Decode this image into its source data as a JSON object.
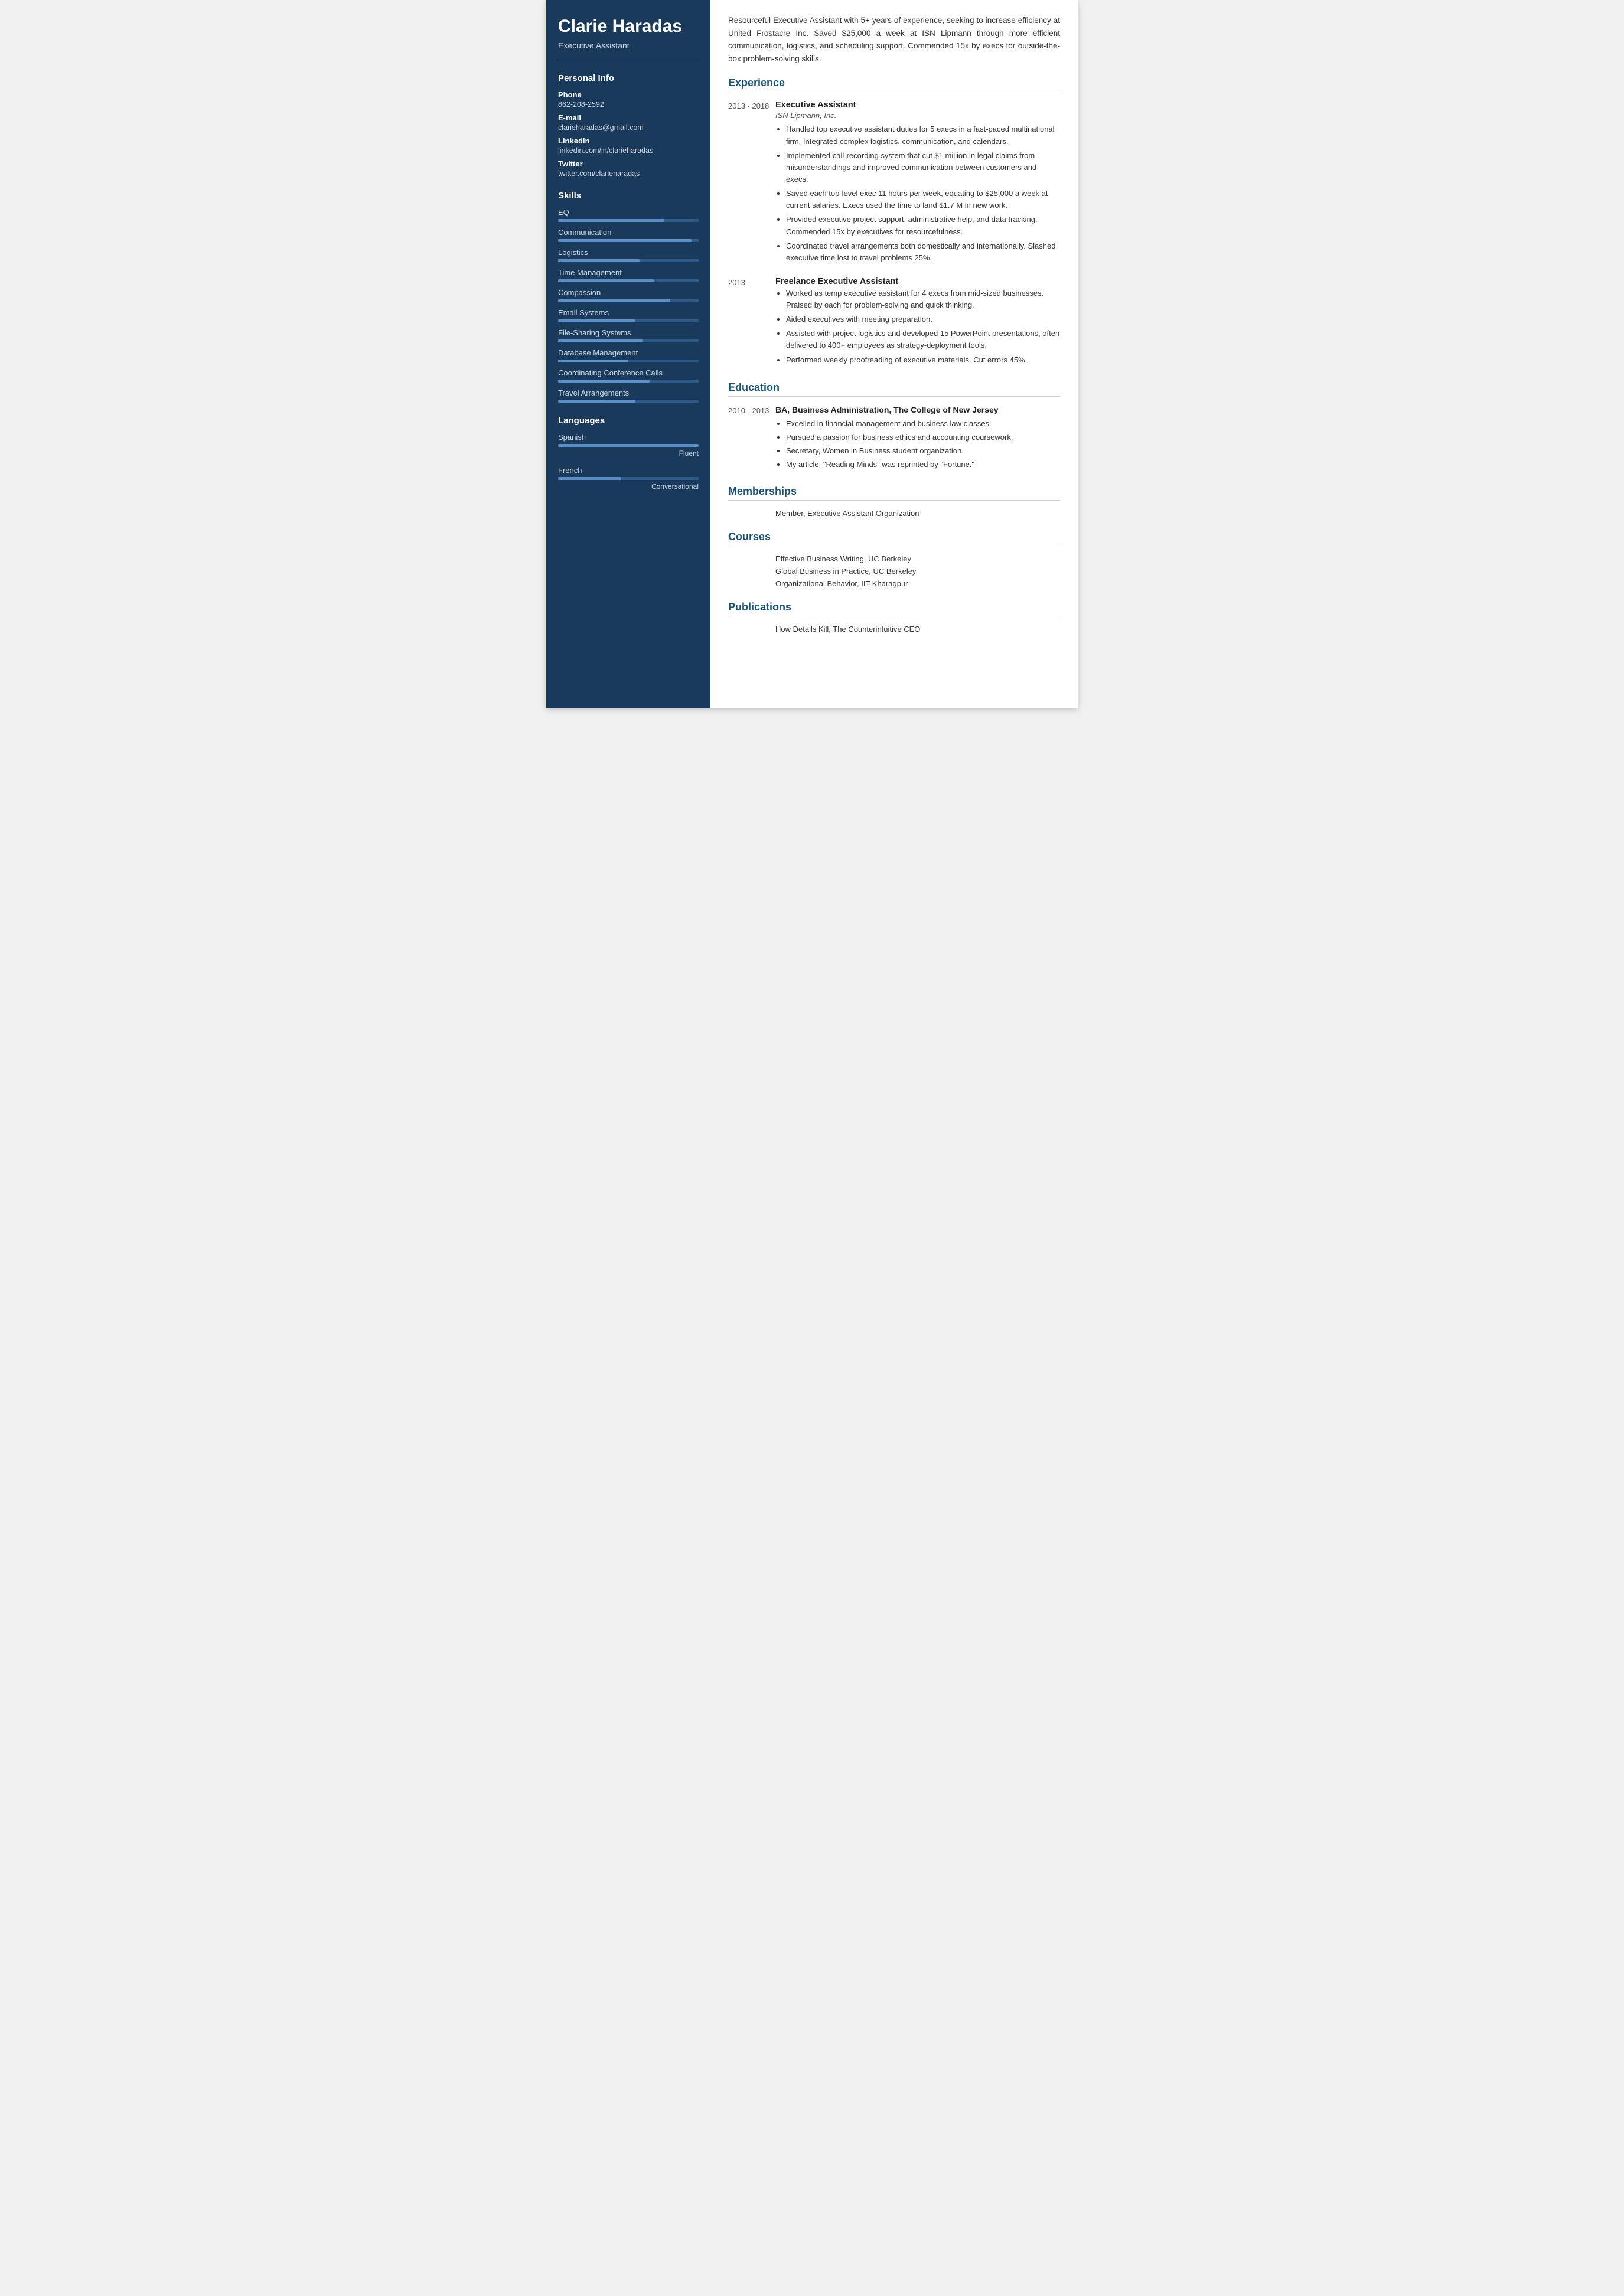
{
  "sidebar": {
    "name": "Clarie Haradas",
    "title": "Executive Assistant",
    "personal_info": {
      "label": "Personal Info",
      "phone_label": "Phone",
      "phone": "862-208-2592",
      "email_label": "E-mail",
      "email": "clarieharadas@gmail.com",
      "linkedin_label": "LinkedIn",
      "linkedin": "linkedin.com/in/clarieharadas",
      "twitter_label": "Twitter",
      "twitter": "twitter.com/clarieharadas"
    },
    "skills": {
      "label": "Skills",
      "items": [
        {
          "name": "EQ",
          "pct": 75
        },
        {
          "name": "Communication",
          "pct": 95
        },
        {
          "name": "Logistics",
          "pct": 58
        },
        {
          "name": "Time Management",
          "pct": 68
        },
        {
          "name": "Compassion",
          "pct": 80
        },
        {
          "name": "Email Systems",
          "pct": 55
        },
        {
          "name": "File-Sharing Systems",
          "pct": 60
        },
        {
          "name": "Database Management",
          "pct": 50
        },
        {
          "name": "Coordinating Conference Calls",
          "pct": 65
        },
        {
          "name": "Travel Arrangements",
          "pct": 55
        }
      ]
    },
    "languages": {
      "label": "Languages",
      "items": [
        {
          "name": "Spanish",
          "pct": 100,
          "level": "Fluent"
        },
        {
          "name": "French",
          "pct": 45,
          "level": "Conversational"
        }
      ]
    }
  },
  "main": {
    "summary": "Resourceful Executive Assistant with 5+ years of experience, seeking to increase efficiency at United Frostacre Inc. Saved $25,000 a week at ISN Lipmann through more efficient communication, logistics, and scheduling support. Commended 15x by execs for outside-the-box problem-solving skills.",
    "experience": {
      "label": "Experience",
      "entries": [
        {
          "date": "2013 - 2018",
          "title": "Executive Assistant",
          "company": "ISN Lipmann, Inc.",
          "bullets": [
            "Handled top executive assistant duties for 5 execs in a fast-paced multinational firm. Integrated complex logistics, communication, and calendars.",
            "Implemented call-recording system that cut $1 million in legal claims from misunderstandings and improved communication between customers and execs.",
            "Saved each top-level exec 11 hours per week, equating to $25,000 a week at current salaries. Execs used the time to land $1.7 M in new work.",
            "Provided executive project support, administrative help, and data tracking. Commended 15x by executives for resourcefulness.",
            "Coordinated travel arrangements both domestically and internationally. Slashed executive time lost to travel problems 25%."
          ]
        },
        {
          "date": "2013",
          "title": "Freelance Executive Assistant",
          "company": "",
          "bullets": [
            "Worked as temp executive assistant for 4 execs from mid-sized businesses. Praised by each for problem-solving and quick thinking.",
            "Aided executives with meeting preparation.",
            "Assisted with project logistics and developed 15 PowerPoint presentations, often delivered to 400+ employees as strategy-deployment tools.",
            "Performed weekly proofreading of executive materials. Cut errors 45%."
          ]
        }
      ]
    },
    "education": {
      "label": "Education",
      "entries": [
        {
          "date": "2010 - 2013",
          "degree": "BA, Business Administration, The College of New Jersey",
          "bullets": [
            "Excelled in financial management and business law classes.",
            "Pursued a passion for business ethics and accounting coursework.",
            "Secretary, Women in Business student organization.",
            "My article, \"Reading Minds\" was reprinted by \"Fortune.\""
          ]
        }
      ]
    },
    "memberships": {
      "label": "Memberships",
      "items": [
        "Member, Executive Assistant Organization"
      ]
    },
    "courses": {
      "label": "Courses",
      "items": [
        "Effective Business Writing, UC Berkeley",
        "Global Business in Practice, UC Berkeley",
        "Organizational Behavior, IIT Kharagpur"
      ]
    },
    "publications": {
      "label": "Publications",
      "items": [
        "How Details Kill, The Counterintuitive CEO"
      ]
    }
  }
}
